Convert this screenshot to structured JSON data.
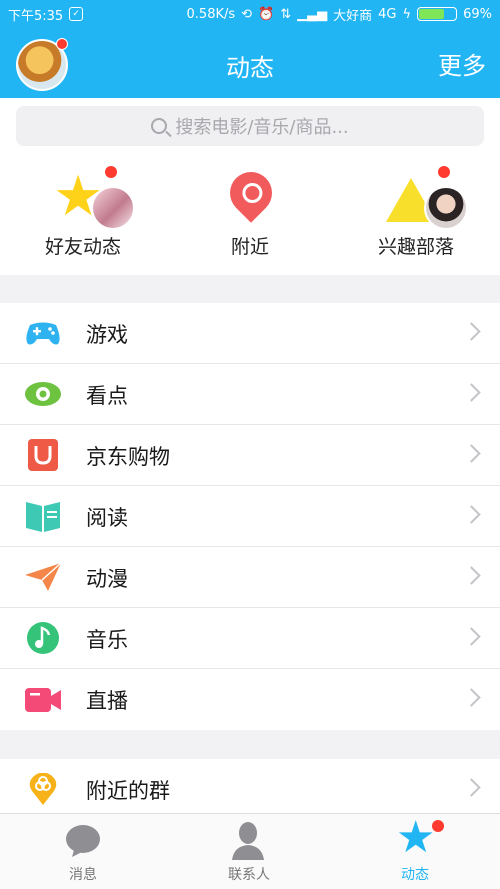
{
  "status_bar": {
    "time": "下午5:35",
    "speed": "0.58K/s",
    "carrier": "大好商",
    "network": "4G",
    "battery_percent": "69%",
    "battery_level": 0.69
  },
  "header": {
    "title": "动态",
    "more_label": "更多"
  },
  "search": {
    "placeholder": "搜索电影/音乐/商品..."
  },
  "quick_entries": [
    {
      "label": "好友动态",
      "icon": "star-icon",
      "has_badge": true
    },
    {
      "label": "附近",
      "icon": "location-pin-icon",
      "has_badge": false
    },
    {
      "label": "兴趣部落",
      "icon": "tent-icon",
      "has_badge": true
    }
  ],
  "menu_group_1": [
    {
      "label": "游戏",
      "icon": "gamepad-icon",
      "color": "#2fb3f0"
    },
    {
      "label": "看点",
      "icon": "eye-icon",
      "color": "#6dc23f"
    },
    {
      "label": "京东购物",
      "icon": "shopping-bag-icon",
      "color": "#ee5a45"
    },
    {
      "label": "阅读",
      "icon": "book-icon",
      "color": "#3ec9b5"
    },
    {
      "label": "动漫",
      "icon": "paper-plane-icon",
      "color": "#f5864a"
    },
    {
      "label": "音乐",
      "icon": "music-note-icon",
      "color": "#35c37a"
    },
    {
      "label": "直播",
      "icon": "video-camera-icon",
      "color": "#f44a77"
    }
  ],
  "menu_group_2": [
    {
      "label": "附近的群",
      "icon": "group-pin-icon",
      "color": "#f7b21a"
    }
  ],
  "tabs": [
    {
      "label": "消息",
      "icon": "chat-bubble-icon",
      "active": false
    },
    {
      "label": "联系人",
      "icon": "person-icon",
      "active": false
    },
    {
      "label": "动态",
      "icon": "star-icon",
      "active": true
    }
  ],
  "colors": {
    "accent": "#22b5f4",
    "badge": "#ff3b30"
  }
}
